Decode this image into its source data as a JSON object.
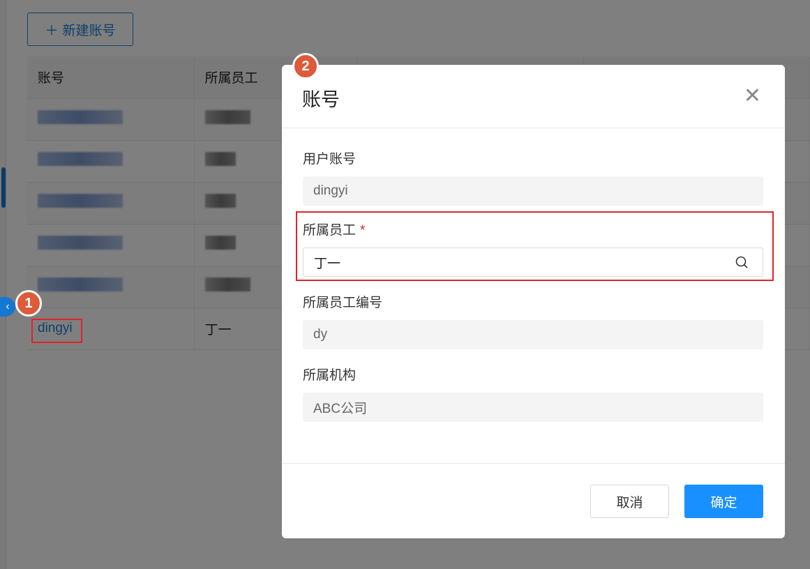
{
  "toolbar": {
    "new_account_label": "新建账号"
  },
  "table": {
    "headers": [
      "账号",
      "所属员工"
    ],
    "last_row": {
      "account": "dingyi",
      "employee": "丁一"
    }
  },
  "badges": [
    "1",
    "2"
  ],
  "modal": {
    "title": "账号",
    "fields": [
      {
        "label": "用户账号",
        "value": "dingyi"
      },
      {
        "label": "所属员工",
        "value": "丁一",
        "required_mark": "*"
      },
      {
        "label": "所属员工编号",
        "value": "dy"
      },
      {
        "label": "所属机构",
        "value": "ABC公司"
      }
    ],
    "cancel_label": "取消",
    "ok_label": "确定"
  },
  "colors": {
    "primary": "#1890ff",
    "highlight": "#e0222a",
    "badge": "#dd5a3a"
  }
}
